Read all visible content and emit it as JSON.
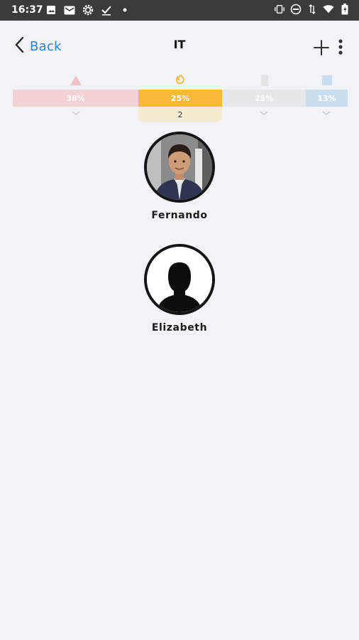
{
  "status_bar": {
    "time": "16:37",
    "left_icons": [
      "image-icon",
      "mail-icon",
      "settings-icon",
      "check-icon",
      "dot-icon"
    ],
    "right_icons": [
      "vibrate-icon",
      "do-not-disturb-icon",
      "data-icon",
      "wifi-icon",
      "battery-icon"
    ]
  },
  "header": {
    "back_label": "Back",
    "title": "IT"
  },
  "distribution": {
    "segments": [
      {
        "label": "38%",
        "value": 38,
        "color": "#f3d2d5",
        "icon": "triangle-icon",
        "icon_color": "#f0c2c6"
      },
      {
        "label": "25%",
        "value": 25,
        "color": "#f8b93a",
        "icon": "flame-icon",
        "icon_color": "#f5b73a",
        "selected": true,
        "count": "2"
      },
      {
        "label": "25%",
        "value": 25,
        "color": "#e6e7ea",
        "icon": "rectangle-icon",
        "icon_color": "#e3e4e8"
      },
      {
        "label": "13%",
        "value": 13,
        "color": "#c9def0",
        "icon": "square-icon",
        "icon_color": "#c8ddf0"
      }
    ]
  },
  "members": [
    {
      "name": "Fernando",
      "avatar": "photo-avatar"
    },
    {
      "name": "Elizabeth",
      "avatar": "silhouette-avatar"
    }
  ]
}
